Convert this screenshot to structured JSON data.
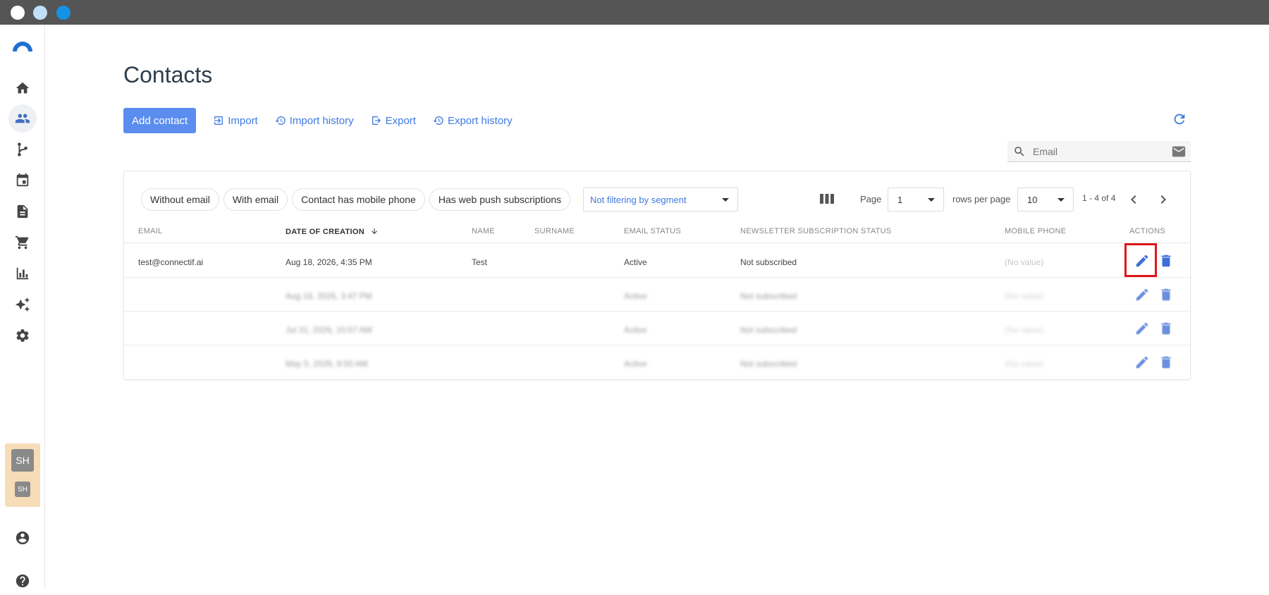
{
  "window": {
    "controls": [
      "close",
      "minimize",
      "maximize"
    ]
  },
  "sidebar": {
    "items": [
      {
        "icon": "home-icon",
        "active": false
      },
      {
        "icon": "contacts-icon",
        "active": true
      },
      {
        "icon": "workflow-icon",
        "active": false
      },
      {
        "icon": "calendar-icon",
        "active": false
      },
      {
        "icon": "document-icon",
        "active": false
      },
      {
        "icon": "cart-icon",
        "active": false
      },
      {
        "icon": "bar-chart-icon",
        "active": false
      },
      {
        "icon": "sparkles-icon",
        "active": false
      },
      {
        "icon": "settings-icon",
        "active": false
      }
    ],
    "account": {
      "avatar_big": "SH",
      "avatar_small": "SH"
    },
    "bottom": [
      "user-icon",
      "help-icon"
    ]
  },
  "page": {
    "title": "Contacts"
  },
  "toolbar": {
    "add_contact": "Add contact",
    "import": "Import",
    "import_history": "Import history",
    "export": "Export",
    "export_history": "Export history"
  },
  "search": {
    "placeholder": "Email"
  },
  "filters": {
    "chips": [
      "Without email",
      "With email",
      "Contact has mobile phone",
      "Has web push subscriptions"
    ],
    "segment": "Not filtering by segment"
  },
  "pagination": {
    "page_label": "Page",
    "page_value": "1",
    "rows_label": "rows per page",
    "rows_value": "10",
    "range": "1 - 4 of 4"
  },
  "table": {
    "headers": {
      "email": "EMAIL",
      "date": "DATE OF CREATION",
      "name": "NAME",
      "surname": "SURNAME",
      "email_status": "EMAIL STATUS",
      "newsletter": "NEWSLETTER SUBSCRIPTION STATUS",
      "mobile": "MOBILE PHONE",
      "actions": "ACTIONS"
    },
    "rows": [
      {
        "email": "test@connectif.ai",
        "date": "Aug 18, 2026, 4:35 PM",
        "name": "Test",
        "surname": "",
        "email_status": "Active",
        "newsletter": "Not subscribed",
        "mobile": "(No value)"
      },
      {
        "email": "",
        "date": "Aug 18, 2026, 3:47 PM",
        "name": "",
        "surname": "",
        "email_status": "Active",
        "newsletter": "Not subscribed",
        "mobile": "(No value)"
      },
      {
        "email": "",
        "date": "Jul 31, 2026, 10:57 AM",
        "name": "",
        "surname": "",
        "email_status": "Active",
        "newsletter": "Not subscribed",
        "mobile": "(No value)"
      },
      {
        "email": "",
        "date": "May 5, 2026, 8:50 AM",
        "name": "",
        "surname": "",
        "email_status": "Active",
        "newsletter": "Not subscribed",
        "mobile": "(No value)"
      }
    ]
  },
  "colors": {
    "primary": "#5b8def",
    "link": "#3f7ae0",
    "highlight": "#e0161b",
    "titlebar": "#555555"
  }
}
